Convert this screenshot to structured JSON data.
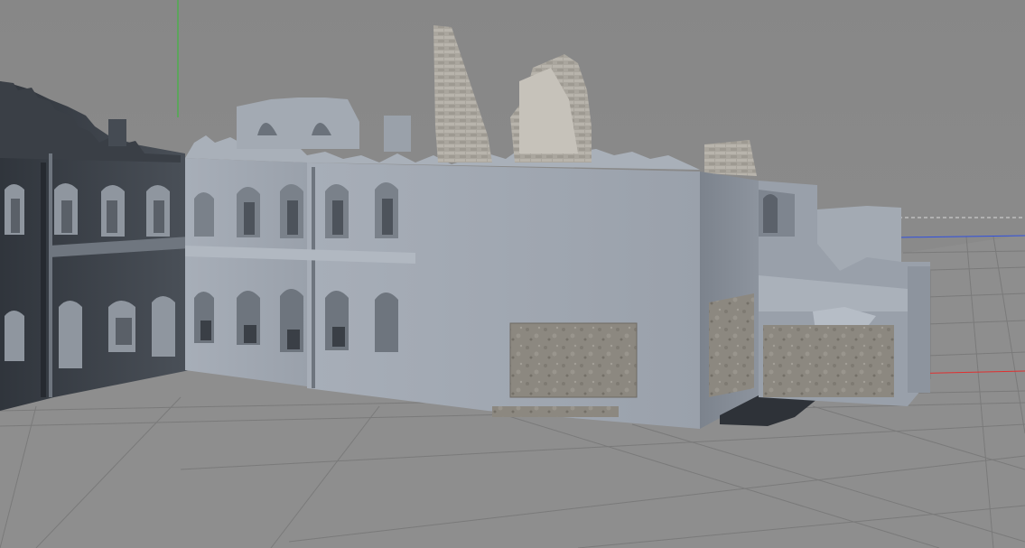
{
  "viewport": {
    "title": "",
    "background_color": "#8a8a8a",
    "floor_color": "#8e8e8e",
    "grid_line_color": "#7a7a7a",
    "axis_x_color": "#e03030",
    "axis_y_color": "#30c030",
    "axis_z_color": "#3050e0",
    "horizon_dashed_color": "#d0d0d0"
  },
  "scene": {
    "object_description_icon": "ruined-building-model",
    "material_colors": {
      "wall_light": "#a4abb4",
      "wall_mid": "#949ba4",
      "wall_dark": "#3c4148",
      "side_face": "#858c96",
      "stone_texture": "#8f8b84",
      "brick_ruin": "#a9a59c",
      "door_slab": "#2c3036"
    }
  }
}
